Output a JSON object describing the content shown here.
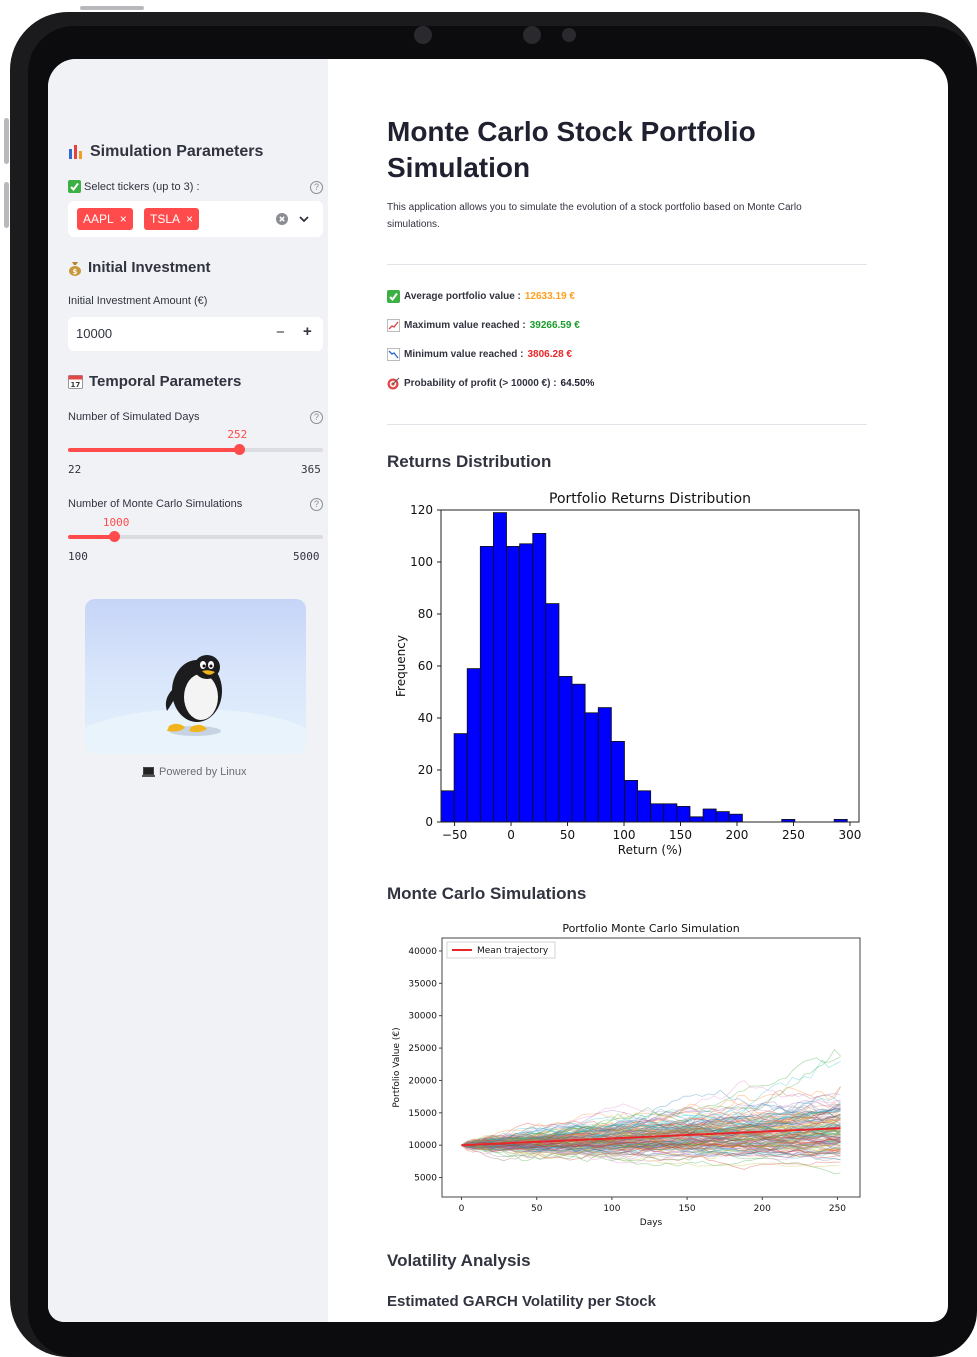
{
  "sidebar": {
    "sim_params_title": "Simulation Parameters",
    "ticker_label": "Select tickers (up to 3) :",
    "tickers": [
      "AAPL",
      "TSLA"
    ],
    "initial_title": "Initial Investment",
    "investment_label": "Initial Investment Amount (€)",
    "investment_value": "10000",
    "temporal_title": "Temporal Parameters",
    "days_label": "Number of Simulated Days",
    "days_value": "252",
    "days_min": "22",
    "days_max": "365",
    "days_fraction": 0.672,
    "sims_label": "Number of Monte Carlo Simulations",
    "sims_value": "1000",
    "sims_min": "100",
    "sims_max": "5000",
    "sims_fraction": 0.184,
    "powered_by": "Powered by Linux",
    "icons": [
      "bar-chart-icon",
      "check-box-icon",
      "money-bag-icon",
      "calendar-icon",
      "help-icon",
      "clear-icon",
      "chevron-down-icon",
      "minus-icon",
      "plus-icon",
      "laptop-icon",
      "penguin-icon"
    ]
  },
  "main": {
    "title": "Monte Carlo Stock Portfolio Simulation",
    "intro": "This application allows you to simulate the evolution of a stock portfolio based on Monte Carlo simulations.",
    "stats": [
      {
        "label": "Average portfolio value :",
        "value": "12633.19 €",
        "color": "#ff9f1c",
        "icon": "check-box-icon"
      },
      {
        "label": "Maximum value reached :",
        "value": "39266.59 €",
        "color": "#1a9d2b",
        "icon": "chart-up-icon"
      },
      {
        "label": "Minimum value reached :",
        "value": "3806.28 €",
        "color": "#e8262a",
        "icon": "chart-down-icon"
      },
      {
        "label": "Probability of profit (> 10000 €) :",
        "value": "64.50%",
        "color": "#1f2030",
        "icon": "target-icon"
      }
    ],
    "returns_section": "Returns Distribution",
    "mc_section": "Monte Carlo Simulations",
    "vol_section": "Volatility Analysis",
    "garch_sub": "Estimated GARCH Volatility per Stock"
  },
  "chart_data": [
    {
      "type": "bar",
      "title": "Portfolio Returns Distribution",
      "xlabel": "Return (%)",
      "ylabel": "Frequency",
      "xlim": [
        -62,
        308
      ],
      "ylim": [
        0,
        120
      ],
      "xticks": [
        -50,
        0,
        50,
        100,
        150,
        200,
        250,
        300
      ],
      "yticks": [
        0,
        20,
        40,
        60,
        80,
        100,
        120
      ],
      "color": "#0000ff",
      "bin_start": -62,
      "bin_width": 11.6,
      "values": [
        12,
        34,
        59,
        106,
        119,
        106,
        107,
        111,
        84,
        56,
        53,
        42,
        44,
        31,
        16,
        12,
        7,
        7,
        6,
        2,
        5,
        4,
        3,
        0,
        0,
        0,
        1,
        0,
        0,
        0,
        1
      ]
    },
    {
      "type": "line",
      "title": "Portfolio Monte Carlo Simulation",
      "xlabel": "Days",
      "ylabel": "Portfolio Value (€)",
      "xlim": [
        -13,
        265
      ],
      "ylim": [
        2000,
        42000
      ],
      "xticks": [
        0,
        50,
        100,
        150,
        200,
        250
      ],
      "yticks": [
        5000,
        10000,
        15000,
        20000,
        25000,
        30000,
        35000,
        40000
      ],
      "legend": "top-left",
      "series": [
        {
          "name": "Mean trajectory",
          "x": [
            0,
            252
          ],
          "values": [
            10000,
            12633
          ],
          "color": "#e8262a"
        }
      ],
      "path_count": 1000,
      "start_value": 10000,
      "days": 252
    }
  ]
}
